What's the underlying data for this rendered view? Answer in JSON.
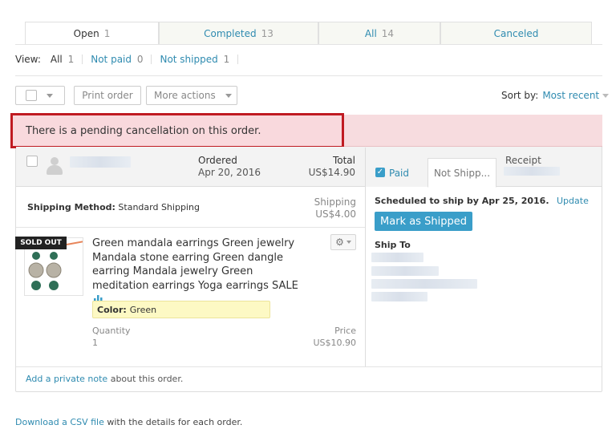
{
  "tabs": [
    {
      "label": "Open",
      "count": "1"
    },
    {
      "label": "Completed",
      "count": "13"
    },
    {
      "label": "All",
      "count": "14"
    },
    {
      "label": "Canceled",
      "count": ""
    }
  ],
  "view": {
    "label": "View:",
    "filters": [
      {
        "label": "All",
        "count": "1"
      },
      {
        "label": "Not paid",
        "count": "0"
      },
      {
        "label": "Not shipped",
        "count": "1"
      }
    ]
  },
  "toolbar": {
    "print_label": "Print order",
    "more_label": "More actions",
    "sort_label": "Sort by:",
    "sort_value": "Most recent"
  },
  "alert": "There is a pending cancellation on this order.",
  "order": {
    "ordered_label": "Ordered",
    "ordered_date": "Apr 20, 2016",
    "total_label": "Total",
    "total_value": "US$14.90",
    "paid_tab": "Paid",
    "not_shipped_tab": "Not Shipp...",
    "receipt_label": "Receipt",
    "shipping_method_label": "Shipping Method:",
    "shipping_method_value": "Standard Shipping",
    "shipping_label": "Shipping",
    "shipping_value": "US$4.00",
    "sold_out_badge": "SOLD OUT",
    "item_title": "Green mandala earrings Green jewelry Mandala stone earring Green dangle earring Mandala jewelry Green meditation earrings Yoga earrings SALE",
    "variation_label": "Color:",
    "variation_value": "Green",
    "quantity_label": "Quantity",
    "quantity_value": "1",
    "price_label": "Price",
    "price_value": "US$10.90",
    "scheduled_text": "Scheduled to ship by Apr 25, 2016.",
    "update_link": "Update",
    "mark_shipped_button": "Mark as Shipped",
    "ship_to_label": "Ship To",
    "note_link": "Add a private note",
    "note_suffix": "about this order."
  },
  "footer": {
    "csv_link": "Download a CSV file",
    "csv_suffix": "with the details for each order."
  },
  "colors": {
    "link": "#2f8bb0",
    "alert_border": "#c01b22",
    "alert_bg": "#f7dcdf",
    "primary_button": "#3a9ec9",
    "variation_bg": "#fdf9c4"
  }
}
